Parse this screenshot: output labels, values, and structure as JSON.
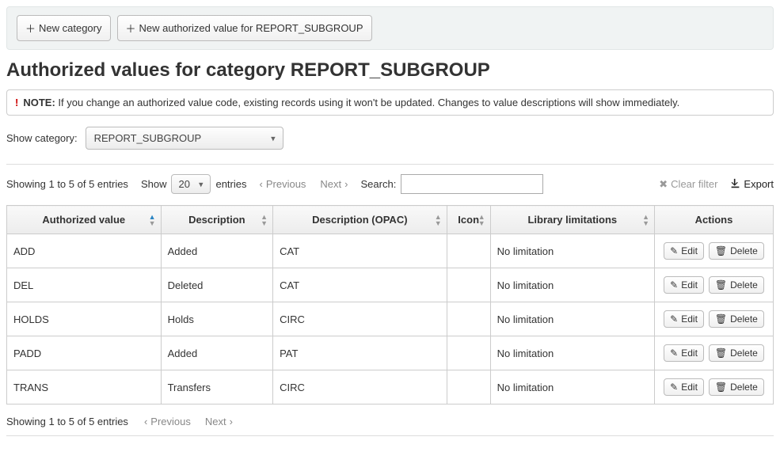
{
  "toolbar": {
    "new_category_label": "New category",
    "new_av_label": "New authorized value for REPORT_SUBGROUP"
  },
  "title": "Authorized values for category REPORT_SUBGROUP",
  "note": {
    "label": "NOTE:",
    "text": "If you change an authorized value code, existing records using it won't be updated. Changes to value descriptions will show immediately."
  },
  "show_category": {
    "label": "Show category:",
    "selected": "REPORT_SUBGROUP"
  },
  "datatable": {
    "info": "Showing 1 to 5 of 5 entries",
    "show_label": "Show",
    "entries_label": "entries",
    "page_length": "20",
    "previous": "Previous",
    "next": "Next",
    "search_label": "Search:",
    "search_value": "",
    "clear_filter": "Clear filter",
    "export": "Export"
  },
  "columns": {
    "authorized_value": "Authorized value",
    "description": "Description",
    "description_opac": "Description (OPAC)",
    "icon": "Icon",
    "library_limitations": "Library limitations",
    "actions": "Actions"
  },
  "actions": {
    "edit": "Edit",
    "delete": "Delete"
  },
  "rows": [
    {
      "av": "ADD",
      "desc": "Added",
      "opac": "CAT",
      "icon": "",
      "lib": "No limitation"
    },
    {
      "av": "DEL",
      "desc": "Deleted",
      "opac": "CAT",
      "icon": "",
      "lib": "No limitation"
    },
    {
      "av": "HOLDS",
      "desc": "Holds",
      "opac": "CIRC",
      "icon": "",
      "lib": "No limitation"
    },
    {
      "av": "PADD",
      "desc": "Added",
      "opac": "PAT",
      "icon": "",
      "lib": "No limitation"
    },
    {
      "av": "TRANS",
      "desc": "Transfers",
      "opac": "CIRC",
      "icon": "",
      "lib": "No limitation"
    }
  ]
}
